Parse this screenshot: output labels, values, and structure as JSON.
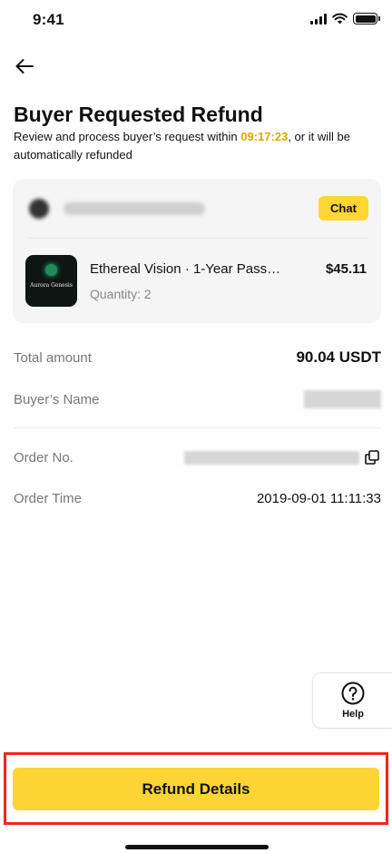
{
  "status_bar": {
    "time": "9:41"
  },
  "header": {
    "title": "Buyer Requested Refund",
    "subtitle_prefix": "Review and process buyer’s request within ",
    "countdown": "09:17:23",
    "subtitle_suffix": ", or it will be automatically refunded"
  },
  "order_card": {
    "chat_label": "Chat",
    "product": {
      "name": "Ethereal Vision · 1-Year Pass…",
      "price": "$45.11",
      "quantity": "Quantity: 2",
      "thumb_text": "Aurora Genesis"
    }
  },
  "details": {
    "total_label": "Total amount",
    "total_value": "90.04 USDT",
    "buyer_label": "Buyer’s Name",
    "order_no_label": "Order No.",
    "order_time_label": "Order Time",
    "order_time_value": "2019-09-01 11:11:33"
  },
  "help": {
    "label": "Help"
  },
  "footer": {
    "refund_details_label": "Refund Details"
  },
  "colors": {
    "accent_yellow": "#fcd535",
    "countdown": "#d9a800",
    "highlight_frame": "#f2261a"
  },
  "icons": [
    "signal-icon",
    "wifi-icon",
    "battery-icon",
    "back-arrow-icon",
    "copy-icon",
    "help-icon"
  ]
}
